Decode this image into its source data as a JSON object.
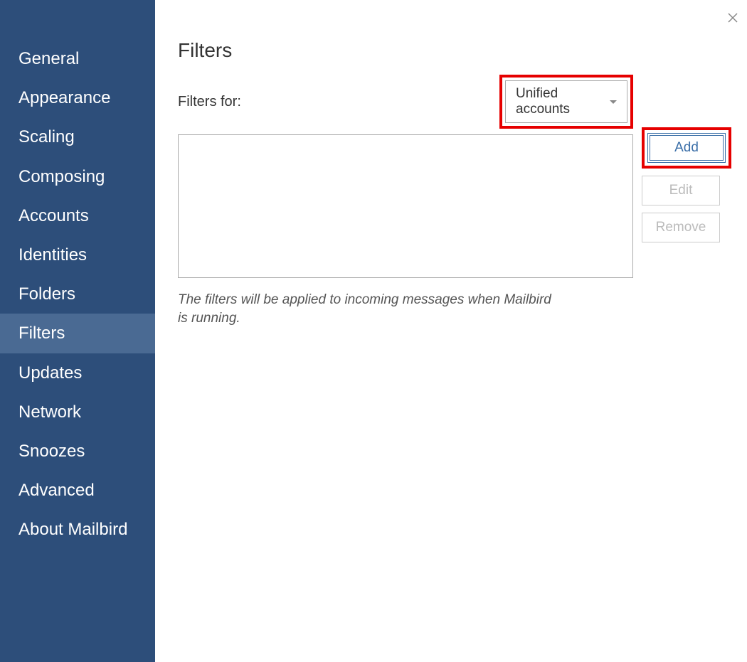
{
  "sidebar": {
    "items": [
      {
        "label": "General",
        "active": false
      },
      {
        "label": "Appearance",
        "active": false
      },
      {
        "label": "Scaling",
        "active": false
      },
      {
        "label": "Composing",
        "active": false
      },
      {
        "label": "Accounts",
        "active": false
      },
      {
        "label": "Identities",
        "active": false
      },
      {
        "label": "Folders",
        "active": false
      },
      {
        "label": "Filters",
        "active": true
      },
      {
        "label": "Updates",
        "active": false
      },
      {
        "label": "Network",
        "active": false
      },
      {
        "label": "Snoozes",
        "active": false
      },
      {
        "label": "Advanced",
        "active": false
      },
      {
        "label": "About Mailbird",
        "active": false
      }
    ]
  },
  "main": {
    "title": "Filters",
    "filters_for_label": "Filters for:",
    "dropdown_value": "Unified accounts",
    "buttons": {
      "add": "Add",
      "edit": "Edit",
      "remove": "Remove"
    },
    "help_text": "The filters will be applied to incoming messages when Mailbird is running."
  }
}
